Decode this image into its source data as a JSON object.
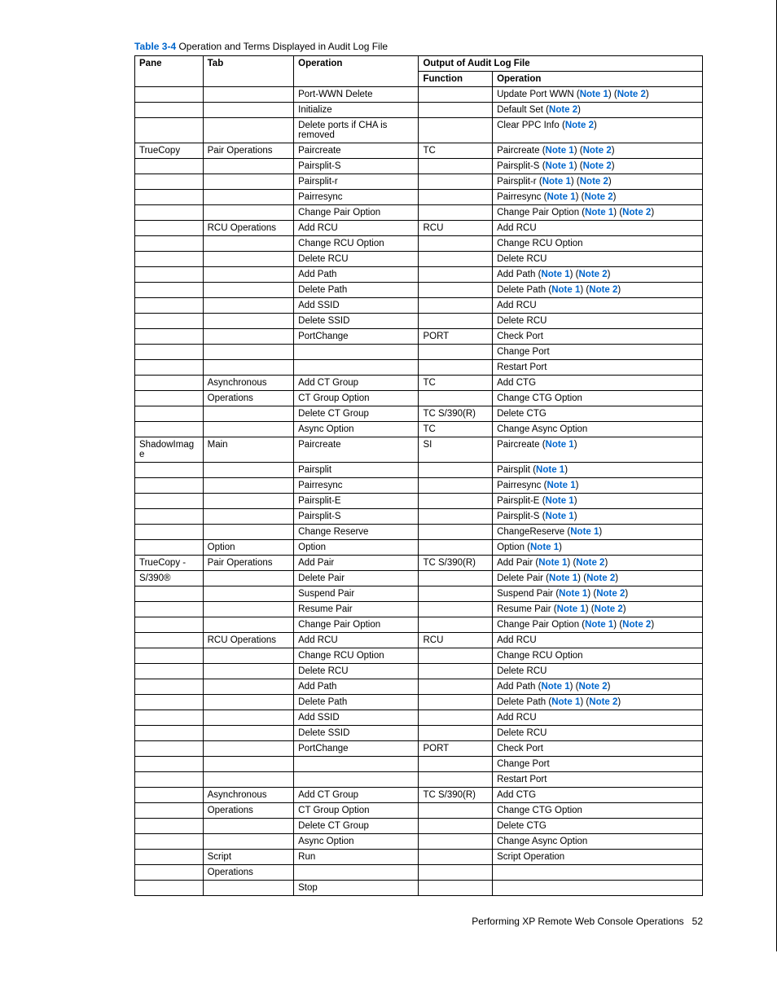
{
  "caption": {
    "label": "Table 3-4",
    "text": " Operation and Terms Displayed in Audit Log File"
  },
  "head": {
    "pane": "Pane",
    "tab": "Tab",
    "operation": "Operation",
    "output": "Output of Audit Log File",
    "function": "Function",
    "operation2": "Operation"
  },
  "rows": [
    {
      "pane": "",
      "tab": "",
      "op": "Port-WWN Delete",
      "fn": "",
      "out": [
        {
          "t": "Update Port WWN "
        },
        {
          "n": "Note 1"
        },
        {
          "t": " "
        },
        {
          "n": "Note 2"
        }
      ]
    },
    {
      "pane": "",
      "tab": "",
      "op": "Initialize",
      "fn": "",
      "out": [
        {
          "t": "Default Set "
        },
        {
          "n": "Note 2"
        }
      ]
    },
    {
      "pane": "",
      "tab": "",
      "op": "Delete ports if CHA is removed",
      "fn": "",
      "out": [
        {
          "t": "Clear PPC Info "
        },
        {
          "n": "Note 2"
        }
      ]
    },
    {
      "pane": "TrueCopy",
      "tab": "Pair Operations",
      "op": "Paircreate",
      "fn": "TC",
      "out": [
        {
          "t": "Paircreate "
        },
        {
          "n": "Note 1"
        },
        {
          "t": " "
        },
        {
          "n": "Note 2"
        }
      ]
    },
    {
      "pane": "",
      "tab": "",
      "op": "Pairsplit-S",
      "fn": "",
      "out": [
        {
          "t": "Pairsplit-S "
        },
        {
          "n": "Note 1"
        },
        {
          "t": " "
        },
        {
          "n": "Note 2"
        }
      ]
    },
    {
      "pane": "",
      "tab": "",
      "op": "Pairsplit-r",
      "fn": "",
      "out": [
        {
          "t": "Pairsplit-r "
        },
        {
          "n": "Note 1"
        },
        {
          "t": " "
        },
        {
          "n": "Note 2"
        }
      ]
    },
    {
      "pane": "",
      "tab": "",
      "op": "Pairresync",
      "fn": "",
      "out": [
        {
          "t": "Pairresync "
        },
        {
          "n": "Note 1"
        },
        {
          "t": " "
        },
        {
          "n": "Note 2"
        }
      ]
    },
    {
      "pane": "",
      "tab": "",
      "op": "Change Pair Option",
      "fn": "",
      "out": [
        {
          "t": "Change Pair Option "
        },
        {
          "n": "Note 1"
        },
        {
          "t": " "
        },
        {
          "n": "Note 2"
        }
      ]
    },
    {
      "pane": "",
      "tab": "RCU Operations",
      "op": "Add RCU",
      "fn": "RCU",
      "out": [
        {
          "t": "Add RCU"
        }
      ]
    },
    {
      "pane": "",
      "tab": "",
      "op": "Change RCU Option",
      "fn": "",
      "out": [
        {
          "t": "Change RCU Option"
        }
      ]
    },
    {
      "pane": "",
      "tab": "",
      "op": "Delete RCU",
      "fn": "",
      "out": [
        {
          "t": "Delete RCU"
        }
      ]
    },
    {
      "pane": "",
      "tab": "",
      "op": "Add Path",
      "fn": "",
      "out": [
        {
          "t": "Add Path "
        },
        {
          "n": "Note 1"
        },
        {
          "t": " "
        },
        {
          "n": "Note 2"
        }
      ]
    },
    {
      "pane": "",
      "tab": "",
      "op": "Delete Path",
      "fn": "",
      "out": [
        {
          "t": "Delete Path "
        },
        {
          "n": "Note 1"
        },
        {
          "t": " "
        },
        {
          "n": "Note 2"
        }
      ]
    },
    {
      "pane": "",
      "tab": "",
      "op": "Add SSID",
      "fn": "",
      "out": [
        {
          "t": "Add RCU"
        }
      ]
    },
    {
      "pane": "",
      "tab": "",
      "op": "Delete SSID",
      "fn": "",
      "out": [
        {
          "t": "Delete RCU"
        }
      ]
    },
    {
      "pane": "",
      "tab": "",
      "op": "PortChange",
      "fn": "PORT",
      "out": [
        {
          "t": "Check Port"
        }
      ]
    },
    {
      "pane": "",
      "tab": "",
      "op": "",
      "fn": "",
      "out": [
        {
          "t": "Change Port"
        }
      ]
    },
    {
      "pane": "",
      "tab": "",
      "op": "",
      "fn": "",
      "out": [
        {
          "t": "Restart Port"
        }
      ]
    },
    {
      "pane": "",
      "tab": "Asynchronous",
      "op": "Add CT Group",
      "fn": "TC",
      "out": [
        {
          "t": "Add CTG"
        }
      ]
    },
    {
      "pane": "",
      "tab": "Operations",
      "op": "CT Group Option",
      "fn": "",
      "out": [
        {
          "t": "Change CTG Option"
        }
      ]
    },
    {
      "pane": "",
      "tab": "",
      "op": "Delete CT Group",
      "fn": "TC S/390(R)",
      "out": [
        {
          "t": "Delete CTG"
        }
      ]
    },
    {
      "pane": "",
      "tab": "",
      "op": "Async Option",
      "fn": "TC",
      "out": [
        {
          "t": "Change Async Option"
        }
      ]
    },
    {
      "pane": "ShadowImage",
      "tab": "Main",
      "op": "Paircreate",
      "fn": "SI",
      "out": [
        {
          "t": "Paircreate "
        },
        {
          "n": "Note 1"
        }
      ]
    },
    {
      "pane": "",
      "tab": "",
      "op": "Pairsplit",
      "fn": "",
      "out": [
        {
          "t": "Pairsplit "
        },
        {
          "n": "Note 1"
        }
      ]
    },
    {
      "pane": "",
      "tab": "",
      "op": "Pairresync",
      "fn": "",
      "out": [
        {
          "t": "Pairresync "
        },
        {
          "n": "Note 1"
        }
      ]
    },
    {
      "pane": "",
      "tab": "",
      "op": "Pairsplit-E",
      "fn": "",
      "out": [
        {
          "t": "Pairsplit-E "
        },
        {
          "n": "Note 1"
        }
      ]
    },
    {
      "pane": "",
      "tab": "",
      "op": "Pairsplit-S",
      "fn": "",
      "out": [
        {
          "t": "Pairsplit-S "
        },
        {
          "n": "Note 1"
        }
      ]
    },
    {
      "pane": "",
      "tab": "",
      "op": "Change Reserve",
      "fn": "",
      "out": [
        {
          "t": "ChangeReserve "
        },
        {
          "n": "Note 1"
        }
      ]
    },
    {
      "pane": "",
      "tab": "Option",
      "op": "Option",
      "fn": "",
      "out": [
        {
          "t": "Option "
        },
        {
          "n": "Note 1"
        }
      ]
    },
    {
      "pane": "TrueCopy -",
      "tab": "Pair Operations",
      "op": "Add Pair",
      "fn": "TC S/390(R)",
      "out": [
        {
          "t": "Add Pair "
        },
        {
          "n": "Note 1"
        },
        {
          "t": " "
        },
        {
          "n": "Note 2"
        }
      ]
    },
    {
      "pane": "S/390®",
      "tab": "",
      "op": "Delete Pair",
      "fn": "",
      "out": [
        {
          "t": "Delete Pair "
        },
        {
          "n": "Note 1"
        },
        {
          "t": " "
        },
        {
          "n": "Note 2"
        }
      ]
    },
    {
      "pane": "",
      "tab": "",
      "op": "Suspend Pair",
      "fn": "",
      "out": [
        {
          "t": "Suspend Pair "
        },
        {
          "n": "Note 1"
        },
        {
          "t": " "
        },
        {
          "n": "Note 2"
        }
      ]
    },
    {
      "pane": "",
      "tab": "",
      "op": "Resume Pair",
      "fn": "",
      "out": [
        {
          "t": "Resume Pair "
        },
        {
          "n": "Note 1"
        },
        {
          "t": " "
        },
        {
          "n": "Note 2"
        }
      ]
    },
    {
      "pane": "",
      "tab": "",
      "op": "Change Pair Option",
      "fn": "",
      "out": [
        {
          "t": "Change Pair Option "
        },
        {
          "n": "Note 1"
        },
        {
          "t": " "
        },
        {
          "n": "Note 2"
        }
      ]
    },
    {
      "pane": "",
      "tab": "RCU Operations",
      "op": "Add RCU",
      "fn": "RCU",
      "out": [
        {
          "t": "Add RCU"
        }
      ]
    },
    {
      "pane": "",
      "tab": "",
      "op": "Change RCU Option",
      "fn": "",
      "out": [
        {
          "t": "Change RCU Option"
        }
      ]
    },
    {
      "pane": "",
      "tab": "",
      "op": "Delete RCU",
      "fn": "",
      "out": [
        {
          "t": "Delete RCU"
        }
      ]
    },
    {
      "pane": "",
      "tab": "",
      "op": "Add Path",
      "fn": "",
      "out": [
        {
          "t": "Add Path "
        },
        {
          "n": "Note 1"
        },
        {
          "t": " "
        },
        {
          "n": "Note 2"
        }
      ]
    },
    {
      "pane": "",
      "tab": "",
      "op": "Delete Path",
      "fn": "",
      "out": [
        {
          "t": "Delete Path "
        },
        {
          "n": "Note 1"
        },
        {
          "t": " "
        },
        {
          "n": "Note 2"
        }
      ]
    },
    {
      "pane": "",
      "tab": "",
      "op": "Add SSID",
      "fn": "",
      "out": [
        {
          "t": "Add RCU"
        }
      ]
    },
    {
      "pane": "",
      "tab": "",
      "op": "Delete SSID",
      "fn": "",
      "out": [
        {
          "t": "Delete RCU"
        }
      ]
    },
    {
      "pane": "",
      "tab": "",
      "op": "PortChange",
      "fn": "PORT",
      "out": [
        {
          "t": "Check Port"
        }
      ]
    },
    {
      "pane": "",
      "tab": "",
      "op": "",
      "fn": "",
      "out": [
        {
          "t": "Change Port"
        }
      ]
    },
    {
      "pane": "",
      "tab": "",
      "op": "",
      "fn": "",
      "out": [
        {
          "t": "Restart Port"
        }
      ]
    },
    {
      "pane": "",
      "tab": "Asynchronous",
      "op": "Add CT Group",
      "fn": "TC S/390(R)",
      "out": [
        {
          "t": "Add CTG"
        }
      ]
    },
    {
      "pane": "",
      "tab": "Operations",
      "op": "CT Group Option",
      "fn": "",
      "out": [
        {
          "t": "Change CTG Option"
        }
      ]
    },
    {
      "pane": "",
      "tab": "",
      "op": "Delete CT Group",
      "fn": "",
      "out": [
        {
          "t": "Delete CTG"
        }
      ]
    },
    {
      "pane": "",
      "tab": "",
      "op": "Async Option",
      "fn": "",
      "out": [
        {
          "t": "Change Async Option"
        }
      ]
    },
    {
      "pane": "",
      "tab": "Script",
      "op": "Run",
      "fn": "",
      "out": [
        {
          "t": "Script Operation"
        }
      ]
    },
    {
      "pane": "",
      "tab": "Operations",
      "op": "",
      "fn": "",
      "out": [
        {
          "t": ""
        }
      ]
    },
    {
      "pane": "",
      "tab": "",
      "op": "Stop",
      "fn": "",
      "out": [
        {
          "t": ""
        }
      ]
    }
  ],
  "footer": {
    "text": "Performing XP Remote Web Console Operations",
    "page": "52"
  }
}
